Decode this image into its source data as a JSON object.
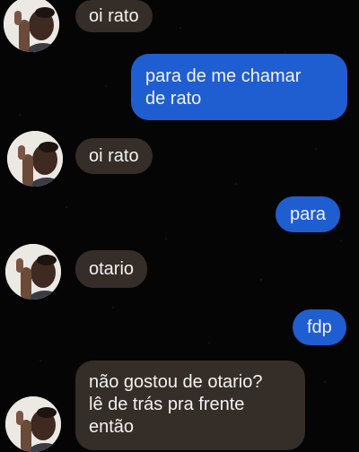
{
  "conversation": {
    "messages": [
      {
        "sender": "other",
        "text": "oi rato"
      },
      {
        "sender": "me",
        "lines": [
          "para de me chamar",
          "de rato"
        ]
      },
      {
        "sender": "other",
        "text": "oi rato"
      },
      {
        "sender": "me",
        "text": "para"
      },
      {
        "sender": "other",
        "text": "otario"
      },
      {
        "sender": "me",
        "text": "fdp"
      },
      {
        "sender": "other",
        "lines": [
          "não gostou de otario?",
          "lê de trás pra frente",
          "então"
        ]
      }
    ]
  },
  "colors": {
    "background": "#050505",
    "incoming_bubble": "#352d28",
    "outgoing_bubble": "#1f5ed1",
    "bubble_text": "#f2f2f2"
  },
  "icons": {
    "sender_avatar": "person-peeking-avatar"
  }
}
